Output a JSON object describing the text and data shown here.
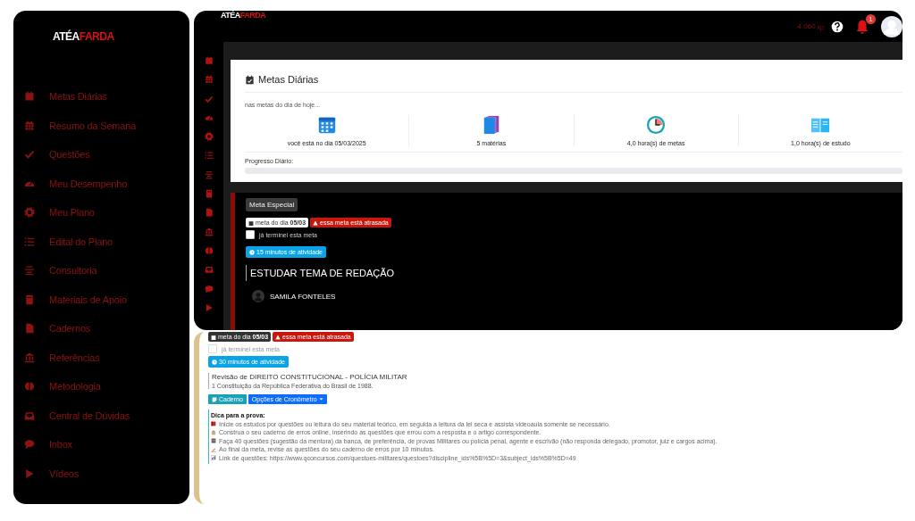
{
  "sidebar": {
    "logo": {
      "text_1": "ATÉA",
      "text_2": "FARDA"
    },
    "items": [
      {
        "label": "Metas Diárias"
      },
      {
        "label": "Resumo da Semana"
      },
      {
        "label": "Questões"
      },
      {
        "label": "Meu Desempenho"
      },
      {
        "label": "Meu Plano"
      },
      {
        "label": "Edital do Plano"
      },
      {
        "label": "Consultoria"
      },
      {
        "label": "Materiais de Apoio"
      },
      {
        "label": "Cadernos"
      },
      {
        "label": "Referências"
      },
      {
        "label": "Metodologia"
      },
      {
        "label": "Central de Dúvidas"
      },
      {
        "label": "Inbox"
      },
      {
        "label": "Vídeos"
      }
    ]
  },
  "topbar": {
    "logo": {
      "text_1": "ATÉA",
      "text_2": "FARDA"
    },
    "xp": "4.060",
    "xp_unit": "xp",
    "notifications": "1"
  },
  "daily_goals": {
    "title": "Metas Diárias",
    "subtitle": "nas metas do dia de hoje...",
    "stats": [
      {
        "label": "você está no dia 05/03/2025"
      },
      {
        "label": "5 matérias"
      },
      {
        "label": "4,0 hora(s) de metas"
      },
      {
        "label": "1,0 hora(s) de estudo"
      }
    ],
    "progress": {
      "label": "Progresso Diário:",
      "level": 0
    }
  },
  "special_goal": {
    "tag": "Meta Especial",
    "date_badge": "meta do dia **05/03**",
    "late_badge": "essa meta está atrasada",
    "checkbox": {
      "label": "já terminei esta meta",
      "checked": false
    },
    "duration": "15 minutos de atividade",
    "title": "ESTUDAR TEMA DE REDAÇÃO",
    "mentor": "SAMILA FONTELES"
  },
  "review_goal": {
    "date_badge": "meta do dia **05/03**",
    "late_badge": "essa meta está atrasada",
    "checkbox": {
      "label": "já terminei esta meta",
      "checked": false
    },
    "duration": "30 minutos de atividade",
    "title": "Revisão de DIREITO CONSTITUCIONAL - POLÍCIA MILITAR",
    "subtitle": "1 Constituição da República Federativa do Brasil de 1988.",
    "buttons": [
      "Caderno",
      "Opções de Cronômetro"
    ],
    "tip_title": "Dica para a prova:",
    "tips": [
      {
        "text": "Inicie os estudos por questões ou leitura do seu material teórico, em seguida a leitura da lei seca e assista videoaula somente se necessário."
      },
      {
        "text": "Construa o seu caderno de erros online, inserindo as questões que errou com a resposta e o artigo correspondente."
      },
      {
        "text": "Faça 40 questões (sugestão da mentora) da banca, de preferência, de provas Militares ou polícia penal, agente e escrivão (não responda delegado, promotor, juiz e cargos acima)."
      },
      {
        "text": "Ao final da meta, revise as questões do seu caderno de erros por 10 minutos."
      },
      {
        "text": "Link de questões: https://www.qconcursos.com/questoes-militares/questoes?discipline_ids%5B%5D=3&subject_ids%5B%5D=49"
      }
    ]
  }
}
